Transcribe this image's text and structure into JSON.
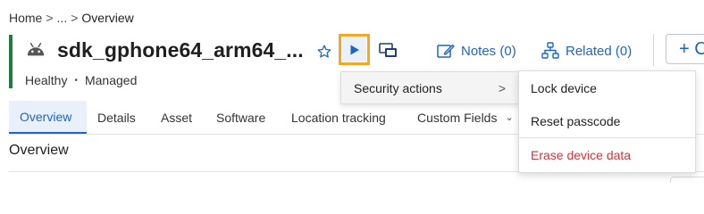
{
  "breadcrumb": {
    "home": "Home",
    "sep1": ">",
    "ellipsis": "...",
    "sep2": ">",
    "current": "Overview"
  },
  "device": {
    "name": "sdk_gphone64_arm64_...",
    "health": "Healthy",
    "management": "Managed"
  },
  "header": {
    "notes_label": "Notes (0)",
    "related_label": "Related (0)",
    "add_label": "+ C"
  },
  "tabs": [
    {
      "label": "Overview",
      "active": true
    },
    {
      "label": "Details"
    },
    {
      "label": "Asset"
    },
    {
      "label": "Software"
    },
    {
      "label": "Location tracking"
    },
    {
      "label": "Custom Fields"
    }
  ],
  "section": {
    "title": "Overview"
  },
  "menu": {
    "security_actions": "Security actions",
    "arrow": ">"
  },
  "submenu": {
    "lock": "Lock device",
    "reset": "Reset passcode",
    "erase": "Erase device data"
  },
  "colors": {
    "accent_green": "#1e7d3f",
    "link_blue": "#1a66c9",
    "highlight_orange": "#f5a623",
    "danger_red": "#d13438"
  },
  "icons": [
    "android-icon",
    "star-icon",
    "play-icon",
    "remote-control-icon",
    "notes-icon",
    "related-icon",
    "chevron-down-icon",
    "chevron-right-icon"
  ]
}
